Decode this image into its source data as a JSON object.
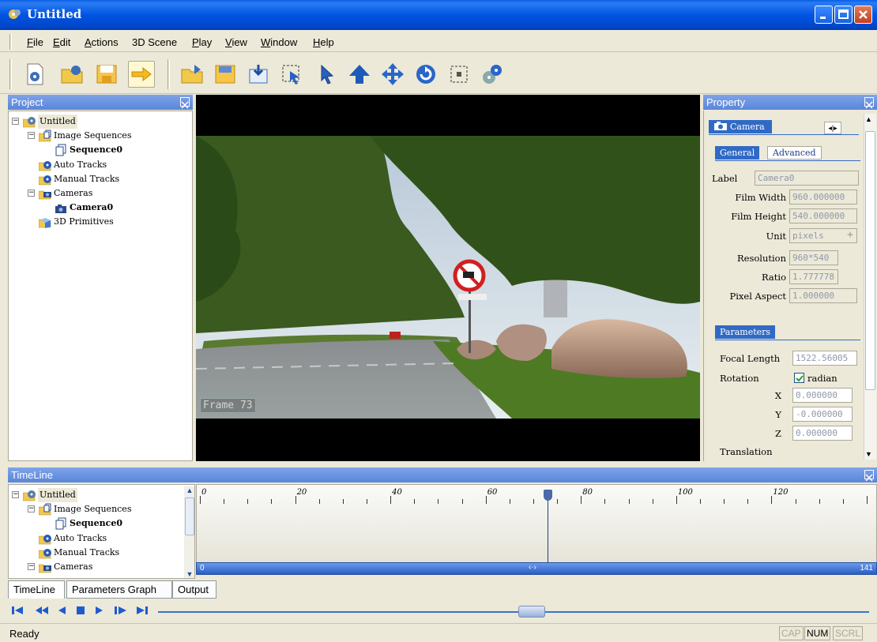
{
  "window": {
    "title": "Untitled"
  },
  "menu": [
    {
      "label": "File",
      "u": "F",
      "rest": "ile"
    },
    {
      "label": "Edit",
      "u": "E",
      "rest": "dit"
    },
    {
      "label": "Actions",
      "u": "A",
      "rest": "ctions"
    },
    {
      "label": "3D Scene",
      "u": "",
      "rest": "3D Scene"
    },
    {
      "label": "Play",
      "u": "P",
      "rest": "lay"
    },
    {
      "label": "View",
      "u": "V",
      "rest": "iew"
    },
    {
      "label": "Window",
      "u": "W",
      "rest": "indow"
    },
    {
      "label": "Help",
      "u": "H",
      "rest": "elp"
    }
  ],
  "project": {
    "header": "Project",
    "tree": [
      {
        "label": "Untitled",
        "level": 0,
        "exp": "−",
        "icon": "project-icon",
        "selected": true
      },
      {
        "label": "Image Sequences",
        "level": 1,
        "exp": "−",
        "icon": "image-sequences-icon"
      },
      {
        "label": "Sequence0",
        "level": 2,
        "bold": true,
        "icon": "sequence-icon"
      },
      {
        "label": "Auto Tracks",
        "level": 1,
        "icon": "tracks-icon"
      },
      {
        "label": "Manual Tracks",
        "level": 1,
        "icon": "tracks-icon"
      },
      {
        "label": "Cameras",
        "level": 1,
        "exp": "−",
        "icon": "camera-icon"
      },
      {
        "label": "Camera0",
        "level": 2,
        "bold": true,
        "icon": "camera-icon"
      },
      {
        "label": "3D Primitives",
        "level": 1,
        "icon": "primitives-icon"
      }
    ]
  },
  "viewer": {
    "frame_label": "Frame 73"
  },
  "property": {
    "header": "Property",
    "object_tab": "Camera",
    "tabs": [
      "General",
      "Advanced"
    ],
    "fields": {
      "label": {
        "name": "Label",
        "value": "Camera0"
      },
      "film_width": {
        "name": "Film Width",
        "value": "960.000000"
      },
      "film_height": {
        "name": "Film Height",
        "value": "540.000000"
      },
      "unit": {
        "name": "Unit",
        "value": "pixels"
      },
      "resolution": {
        "name": "Resolution",
        "value": "960*540"
      },
      "ratio": {
        "name": "Ratio",
        "value": "1.777778"
      },
      "pixel_aspect": {
        "name": "Pixel Aspect",
        "value": "1.000000"
      }
    },
    "parameters_tab": "Parameters",
    "params": {
      "focal_length": {
        "name": "Focal Length",
        "value": "1522.56005"
      },
      "rotation": {
        "name": "Rotation",
        "check_label": "radian",
        "checked": true
      },
      "x": {
        "name": "X",
        "value": "0.000000"
      },
      "y": {
        "name": "Y",
        "value": "-0.000000"
      },
      "z": {
        "name": "Z",
        "value": "0.000000"
      },
      "translation": {
        "name": "Translation"
      }
    }
  },
  "timeline": {
    "header": "TimeLine",
    "tree": [
      {
        "label": "Untitled",
        "level": 0,
        "exp": "−",
        "selected": true
      },
      {
        "label": "Image Sequences",
        "level": 1,
        "exp": "−"
      },
      {
        "label": "Sequence0",
        "level": 2,
        "bold": true
      },
      {
        "label": "Auto Tracks",
        "level": 1
      },
      {
        "label": "Manual Tracks",
        "level": 1
      },
      {
        "label": "Cameras",
        "level": 1,
        "exp": "−"
      }
    ],
    "ruler_labels": [
      "0",
      "20",
      "40",
      "60",
      "80",
      "100",
      "120"
    ],
    "current_frame": 73,
    "start_label": "0",
    "end_label": "141",
    "scroll_label": "‹·›"
  },
  "bottom_tabs": [
    "TimeLine",
    "Parameters Graph",
    "Output"
  ],
  "status": {
    "text": "Ready",
    "indicators": [
      {
        "label": "CAP",
        "on": false
      },
      {
        "label": "NUM",
        "on": true
      },
      {
        "label": "SCRL",
        "on": false
      }
    ]
  }
}
